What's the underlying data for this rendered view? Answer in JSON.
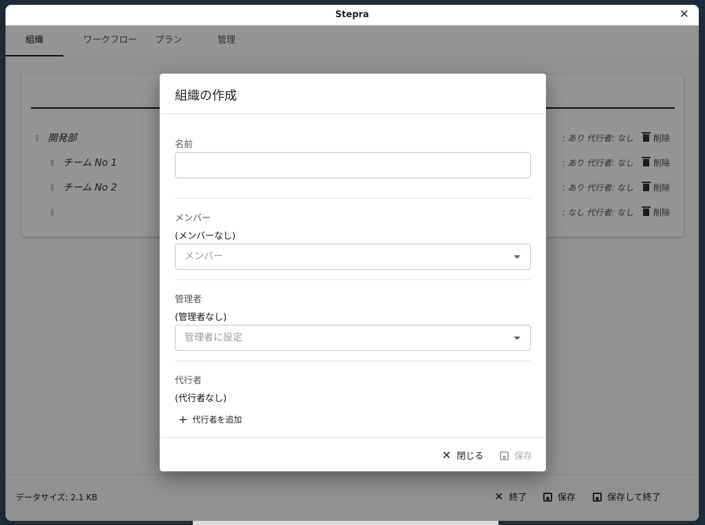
{
  "window": {
    "title": "Stepra",
    "close_glyph": "✕"
  },
  "tabs": [
    {
      "label": "組織",
      "active": true
    },
    {
      "label": "ワークフロー",
      "active": false
    },
    {
      "label": "プラン",
      "active": false
    },
    {
      "label": "管理",
      "active": false
    }
  ],
  "tree": [
    {
      "name": "開発部",
      "meta_right": ": あり   代行者: なし",
      "delete": "削除"
    },
    {
      "name": "チーム No 1",
      "meta_right": ": あり   代行者: なし",
      "delete": "削除"
    },
    {
      "name": "チーム No 2",
      "meta_right": ": あり   代行者: なし",
      "delete": "削除"
    },
    {
      "name": "",
      "meta_right": ": なし   代行者: なし",
      "delete": "削除"
    }
  ],
  "footer": {
    "data_size": "データサイズ: 2.1 KB",
    "exit": "終了",
    "save": "保存",
    "save_and_exit": "保存して終了"
  },
  "dialog": {
    "title": "組織の作成",
    "name": {
      "label": "名前",
      "value": ""
    },
    "members": {
      "label": "メンバー",
      "value": "(メンバーなし)",
      "placeholder": "メンバー"
    },
    "managers": {
      "label": "管理者",
      "value": "(管理者なし)",
      "placeholder": "管理者に設定"
    },
    "deputies": {
      "label": "代行者",
      "value": "(代行者なし)",
      "add": "代行者を追加"
    },
    "close": "閉じる",
    "save": "保存"
  },
  "icons": [
    "close-icon",
    "drag-handle-icon",
    "trash-icon",
    "save-icon",
    "chevron-down-icon",
    "plus-icon"
  ]
}
